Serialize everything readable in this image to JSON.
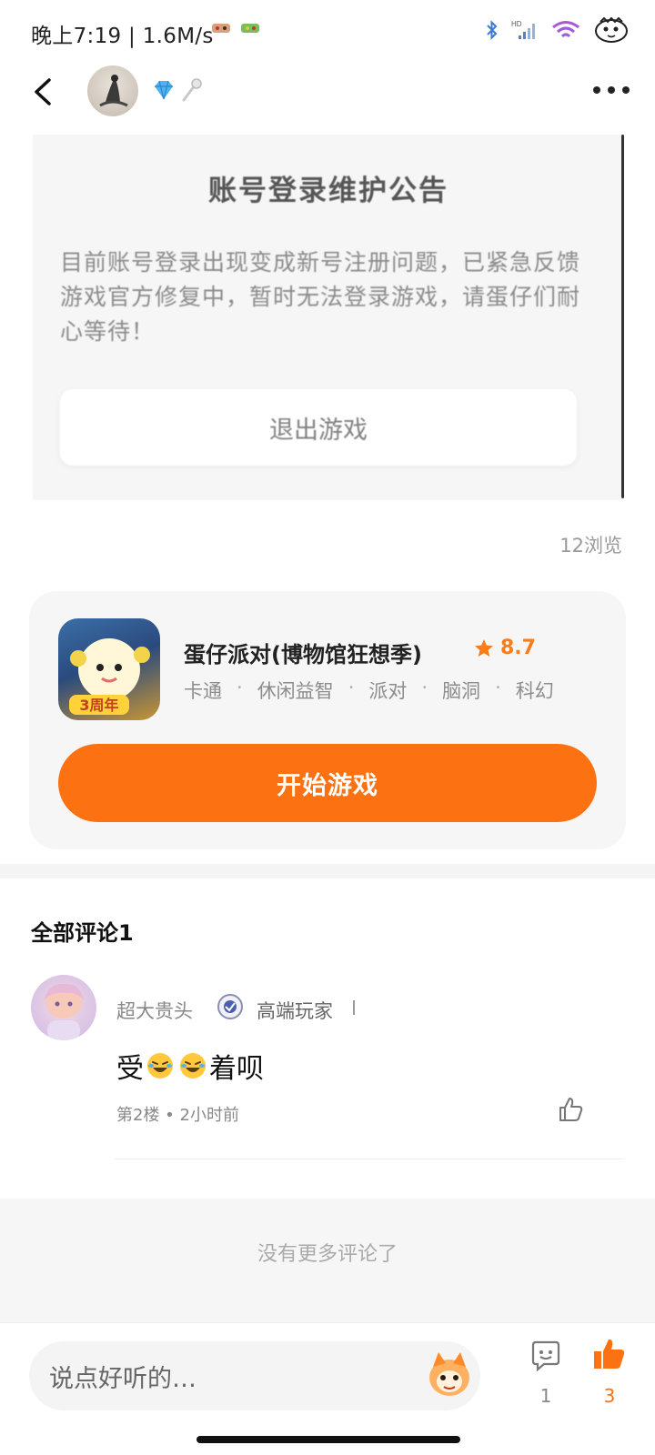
{
  "status_bar": {
    "time_speed": "晚上7:19 | 1.6M/s"
  },
  "post": {
    "embedded_image": {
      "title": "账号登录维护公告",
      "body": "目前账号登录出现变成新号注册问题，已紧急反馈游戏官方修复中，暂时无法登录游戏，请蛋仔们耐心等待！",
      "button_label": "退出游戏"
    },
    "views": "12浏览"
  },
  "game_card": {
    "name": "蛋仔派对(博物馆狂想季)",
    "rating": "8.7",
    "tags": [
      "卡通",
      "休闲益智",
      "派对",
      "脑洞",
      "科幻"
    ],
    "start_label": "开始游戏",
    "icon_text": "3周年"
  },
  "comments": {
    "title": "全部评论1",
    "items": [
      {
        "user": "超大贵头",
        "title": "高端玩家",
        "text_before": "受",
        "text_after": "着呗",
        "meta": "第2楼 • 2小时前"
      }
    ],
    "no_more": "没有更多评论了"
  },
  "bottom_bar": {
    "input_placeholder": "说点好听的…",
    "comment_count": "1",
    "like_count": "3"
  },
  "colors": {
    "accent": "#fc7112",
    "rating": "#fb7d18"
  }
}
